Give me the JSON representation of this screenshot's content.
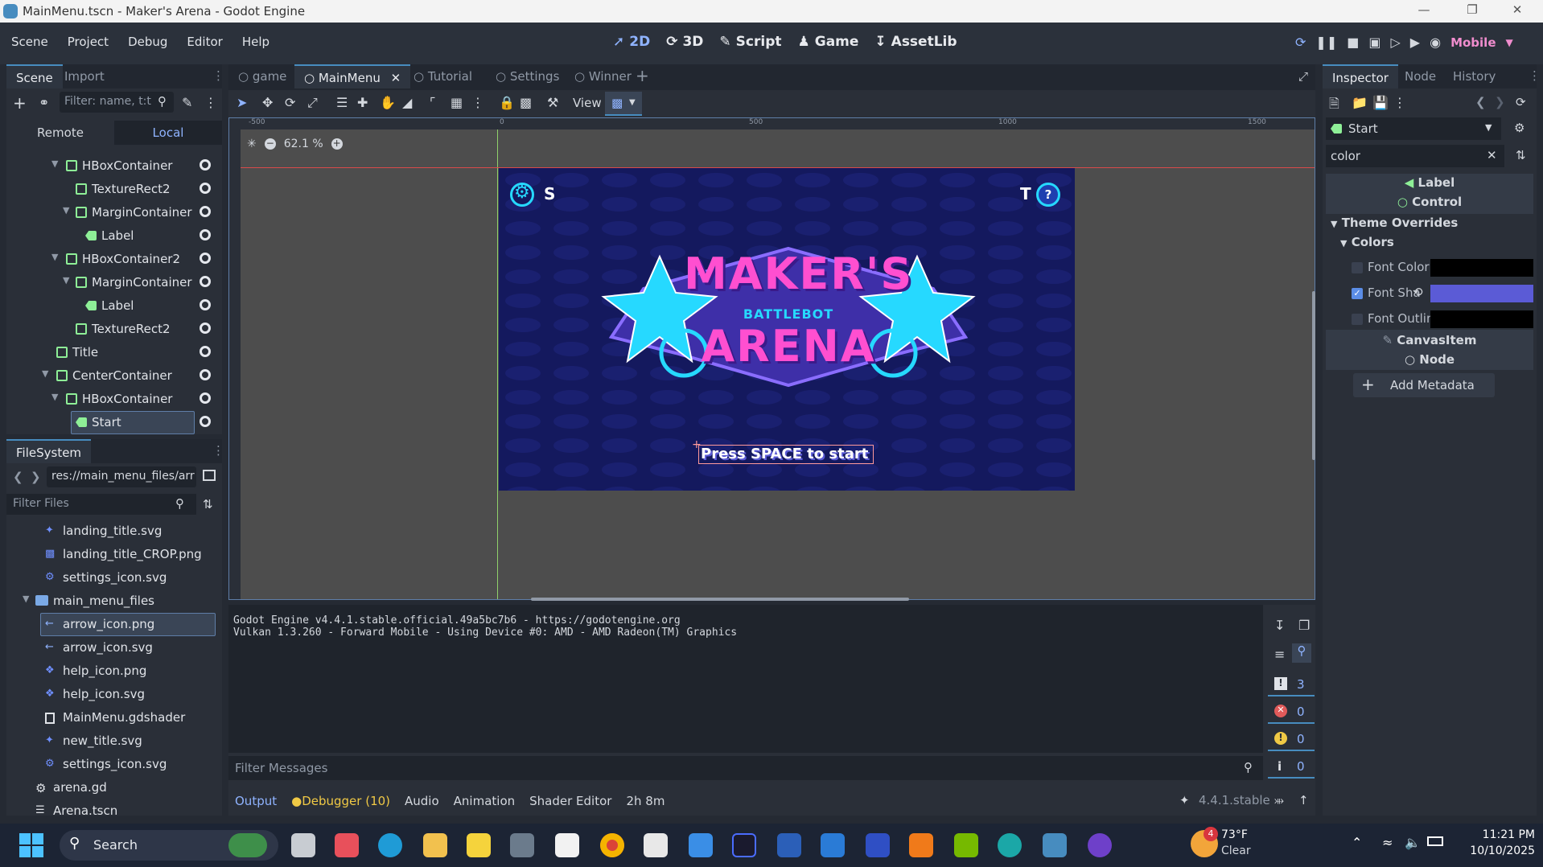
{
  "window": {
    "title": "MainMenu.tscn - Maker's Arena - Godot Engine"
  },
  "menu": [
    "Scene",
    "Project",
    "Debug",
    "Editor",
    "Help"
  ],
  "main_screens": [
    {
      "label": "2D",
      "icon": "2d-icon"
    },
    {
      "label": "3D",
      "icon": "3d-icon"
    },
    {
      "label": "Script",
      "icon": "script-icon"
    },
    {
      "label": "Game",
      "icon": "game-icon"
    },
    {
      "label": "AssetLib",
      "icon": "assetlib-icon"
    }
  ],
  "renderer": "Mobile",
  "scene_dock": {
    "tabs": [
      "Scene",
      "Import"
    ],
    "filter_placeholder": "Filter: name, t:t",
    "remote_label": "Remote",
    "local_label": "Local",
    "tree": [
      {
        "name": "HBoxContainer",
        "type": "hbox"
      },
      {
        "name": "TextureRect2",
        "type": "texture"
      },
      {
        "name": "MarginContainer",
        "type": "margin"
      },
      {
        "name": "Label",
        "type": "label"
      },
      {
        "name": "HBoxContainer2",
        "type": "hbox"
      },
      {
        "name": "MarginContainer",
        "type": "margin"
      },
      {
        "name": "Label",
        "type": "label"
      },
      {
        "name": "TextureRect2",
        "type": "texture"
      },
      {
        "name": "Title",
        "type": "texture"
      },
      {
        "name": "CenterContainer",
        "type": "center"
      },
      {
        "name": "HBoxContainer",
        "type": "hbox"
      },
      {
        "name": "Start",
        "type": "label",
        "selected": true
      }
    ]
  },
  "filesystem": {
    "title": "FileSystem",
    "path": "res://main_menu_files/arr",
    "filter_placeholder": "Filter Files",
    "files": [
      {
        "name": "landing_title.svg",
        "icon": "svg-icon"
      },
      {
        "name": "landing_title_CROP.png",
        "icon": "png-icon"
      },
      {
        "name": "settings_icon.svg",
        "icon": "svg-icon"
      },
      {
        "name": "main_menu_files",
        "icon": "folder-icon"
      },
      {
        "name": "arrow_icon.png",
        "icon": "png-icon",
        "selected": true
      },
      {
        "name": "arrow_icon.svg",
        "icon": "svg-icon"
      },
      {
        "name": "help_icon.png",
        "icon": "png-icon"
      },
      {
        "name": "help_icon.svg",
        "icon": "svg-icon"
      },
      {
        "name": "MainMenu.gdshader",
        "icon": "shader-icon"
      },
      {
        "name": "new_title.svg",
        "icon": "svg-icon"
      },
      {
        "name": "settings_icon.svg",
        "icon": "svg-icon"
      },
      {
        "name": "arena.gd",
        "icon": "gear-icon"
      },
      {
        "name": "Arena.tscn",
        "icon": "scene-icon"
      }
    ]
  },
  "scene_tabs": [
    "game",
    "MainMenu",
    "Tutorial",
    "Settings",
    "Winner"
  ],
  "toolbar": {
    "view_label": "View"
  },
  "viewport": {
    "zoom": "62.1 %",
    "ruler": [
      "-500",
      "0",
      "500",
      "1000",
      "1500"
    ],
    "game": {
      "left_key": "S",
      "right_key": "T",
      "title_line1": "MAKER'S",
      "title_line2": "BATTLEBOT",
      "title_line3": "ARENA",
      "start_text": "Press SPACE to start"
    }
  },
  "output": {
    "lines": [
      "Godot Engine v4.4.1.stable.official.49a5bc7b6 - https://godotengine.org",
      "Vulkan 1.3.260 - Forward Mobile - Using Device #0: AMD - AMD Radeon(TM) Graphics"
    ],
    "filter_placeholder": "Filter Messages",
    "counts": {
      "messages": "3",
      "errors": "0",
      "warnings": "0",
      "info": "0"
    }
  },
  "bottom_tabs": [
    "Output",
    "Debugger (10)",
    "Audio",
    "Animation",
    "Shader Editor"
  ],
  "bottom_status": {
    "time": "2h 8m",
    "version": "4.4.1.stable"
  },
  "inspector": {
    "tabs": [
      "Inspector",
      "Node",
      "History"
    ],
    "node_name": "Start",
    "search_value": "color",
    "sections": {
      "label_class": "Label",
      "control_class": "Control",
      "theme_overrides": "Theme Overrides",
      "colors": "Colors",
      "canvasitem": "CanvasItem",
      "node": "Node",
      "add_metadata": "Add Metadata"
    },
    "props": [
      {
        "name": "Font Color",
        "checked": false,
        "color": "#000000"
      },
      {
        "name": "Font Sha",
        "checked": true,
        "color": "#5b5bd6"
      },
      {
        "name": "Font Outlin",
        "checked": false,
        "color": "#000000"
      }
    ]
  },
  "taskbar": {
    "search_label": "Search",
    "weather_temp": "73°F",
    "weather_desc": "Clear",
    "weather_badge": "4",
    "time": "11:21 PM",
    "date": "10/10/2025"
  },
  "colors": {
    "accent": "#478cbf",
    "game_bg": "#14195e",
    "title_pink": "#ff4fd0",
    "star_cyan": "#26d9ff"
  }
}
